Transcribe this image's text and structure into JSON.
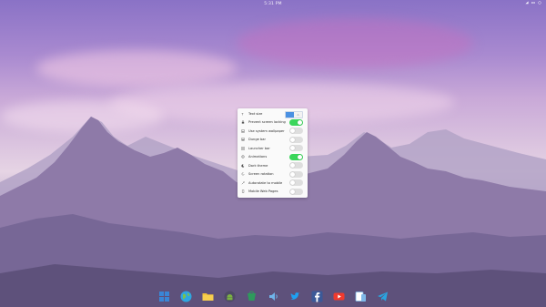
{
  "topbar": {
    "clock": "5:31 PM",
    "icons": [
      "network-icon",
      "battery-icon",
      "menu-icon"
    ]
  },
  "settings_panel": {
    "rows": [
      {
        "label": "Text size",
        "icon": "text-size-icon",
        "control": "segmented",
        "segments": [
          "",
          "A"
        ],
        "active_segment": 0
      },
      {
        "label": "Prevent screen locking",
        "icon": "lock-icon",
        "control": "toggle",
        "on": true
      },
      {
        "label": "Use system wallpaper",
        "icon": "wallpaper-icon",
        "control": "toggle",
        "on": false
      },
      {
        "label": "Dunge bar",
        "icon": "bar-icon",
        "control": "toggle",
        "on": false
      },
      {
        "label": "Launcher bar",
        "icon": "launcher-icon",
        "control": "toggle",
        "on": false
      },
      {
        "label": "Animations",
        "icon": "animation-icon",
        "control": "toggle",
        "on": true
      },
      {
        "label": "Dark theme",
        "icon": "theme-icon",
        "control": "toggle",
        "on": false
      },
      {
        "label": "Screen rotation",
        "icon": "rotation-icon",
        "control": "toggle",
        "on": false
      },
      {
        "label": "Autorotate to mobile",
        "icon": "autorotate-icon",
        "control": "toggle",
        "on": false
      },
      {
        "label": "Mobile Web Pages",
        "icon": "mobile-icon",
        "control": "toggle",
        "on": false
      }
    ]
  },
  "dock": {
    "apps": [
      {
        "icon": "grid-launcher-icon",
        "color": "#3a86d6"
      },
      {
        "icon": "globe-icon",
        "color": "#2fa6e0"
      },
      {
        "icon": "folder-icon",
        "color": "#f3c23a"
      },
      {
        "icon": "android-icon",
        "color": "#7bb342"
      },
      {
        "icon": "store-icon",
        "color": "#2e9a5c"
      },
      {
        "icon": "speaker-icon",
        "color": "#6fb4ea"
      },
      {
        "icon": "twitter-icon",
        "color": "#1da1f2"
      },
      {
        "icon": "facebook-icon",
        "color": "#3b5998"
      },
      {
        "icon": "youtube-icon",
        "color": "#f03a2e"
      },
      {
        "icon": "phone-tablet-icon",
        "color": "#7fb8e8"
      },
      {
        "icon": "telegram-icon",
        "color": "#2aa3df"
      }
    ]
  },
  "colors": {
    "toggle_on": "#3ad65a",
    "toggle_off": "#dedede",
    "accent": "#4a90e2"
  }
}
